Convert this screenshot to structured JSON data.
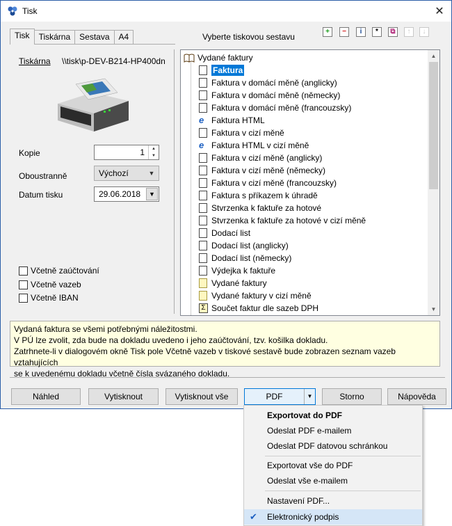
{
  "window": {
    "title": "Tisk"
  },
  "tabs": [
    "Tisk",
    "Tiskárna",
    "Sestava",
    "A4"
  ],
  "select_label": "Vyberte tiskovou sestavu",
  "toolbar": {
    "add": "+",
    "remove": "−",
    "info": "i",
    "star": "*",
    "copy": "⧉",
    "up": "↑",
    "down": "↓"
  },
  "printer": {
    "link_label": "Tiskárna",
    "name": "\\\\tisk\\p-DEV-B214-HP400dn"
  },
  "fields": {
    "copies_label": "Kopie",
    "copies_value": "1",
    "duplex_label": "Oboustranně",
    "duplex_value": "Výchozí",
    "date_label": "Datum tisku",
    "date_value": "29.06.2018"
  },
  "checkboxes": [
    "Včetně zaúčtování",
    "Včetně vazeb",
    "Včetně IBAN"
  ],
  "tree": {
    "root": "Vydané faktury",
    "items": [
      {
        "label": "Faktura",
        "icon": "doc",
        "selected": true
      },
      {
        "label": "Faktura v domácí měně (anglicky)",
        "icon": "doc"
      },
      {
        "label": "Faktura v domácí měně (německy)",
        "icon": "doc"
      },
      {
        "label": "Faktura v domácí měně (francouzsky)",
        "icon": "doc"
      },
      {
        "label": "Faktura HTML",
        "icon": "ie-icon"
      },
      {
        "label": "Faktura v cizí měně",
        "icon": "doc"
      },
      {
        "label": "Faktura HTML v cizí měně",
        "icon": "ie-icon"
      },
      {
        "label": "Faktura v cizí měně (anglicky)",
        "icon": "doc"
      },
      {
        "label": "Faktura v cizí měně (německy)",
        "icon": "doc"
      },
      {
        "label": "Faktura v cizí měně (francouzsky)",
        "icon": "doc"
      },
      {
        "label": "Faktura s příkazem k úhradě",
        "icon": "doc"
      },
      {
        "label": "Stvrzenka k faktuře za hotové",
        "icon": "doc"
      },
      {
        "label": "Stvrzenka k faktuře za hotové v cizí měně",
        "icon": "doc"
      },
      {
        "label": "Dodací list",
        "icon": "doc"
      },
      {
        "label": "Dodací list (anglicky)",
        "icon": "doc"
      },
      {
        "label": "Dodací list (německy)",
        "icon": "doc"
      },
      {
        "label": "Výdejka k faktuře",
        "icon": "doc"
      },
      {
        "label": "Vydané faktury",
        "icon": "doc-yellow"
      },
      {
        "label": "Vydané faktury v cizí měně",
        "icon": "doc-yellow"
      },
      {
        "label": "Součet faktur dle sazeb DPH",
        "icon": "sigma-icon"
      }
    ]
  },
  "description": [
    "Vydaná faktura se všemi potřebnými náležitostmi.",
    "V PÚ lze zvolit, zda bude na dokladu uvedeno i jeho zaúčtování, tzv. košilka dokladu.",
    "Zatrhnete-li v dialogovém okně Tisk pole Včetně vazeb v tiskové sestavě bude zobrazen seznam vazeb vztahujících",
    "se k uvedenému dokladu včetně čísla svázaného dokladu."
  ],
  "buttons": {
    "preview": "Náhled",
    "print": "Vytisknout",
    "print_all": "Vytisknout vše",
    "pdf": "PDF",
    "cancel": "Storno",
    "help": "Nápověda"
  },
  "menu": {
    "export_pdf": "Exportovat do PDF",
    "send_email": "Odeslat PDF e-mailem",
    "send_databox": "Odeslat PDF datovou schránkou",
    "export_all": "Exportovat vše do PDF",
    "send_all_email": "Odeslat vše e-mailem",
    "pdf_settings": "Nastavení PDF...",
    "signature": "Elektronický podpis"
  },
  "colors": {
    "accent": "#0078d7",
    "window_bg": "#f0f0f0",
    "info_bg": "#ffffe1"
  }
}
